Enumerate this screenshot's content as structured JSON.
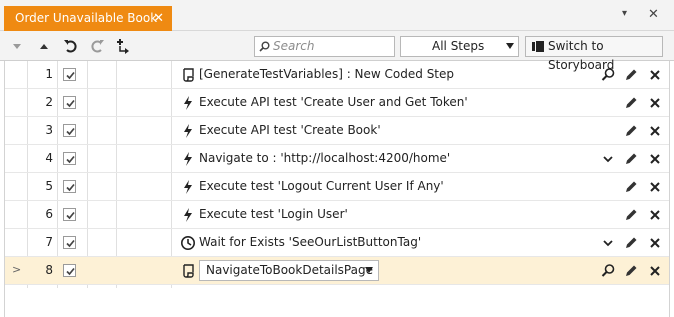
{
  "window": {
    "tab_title": "Order Unavailable Book",
    "tab_close": "✕",
    "menu_glyph": "▾",
    "close_glyph": "✕"
  },
  "toolbar": {
    "search_placeholder": "Search",
    "filter_value": "All Steps",
    "storyboard_label": "Switch to Storyboard"
  },
  "steps": [
    {
      "num": "1",
      "checked": true,
      "type_icon": "coded-step-icon",
      "text": "[GenerateTestVariables] : New Coded Step",
      "actions": [
        "search",
        "edit",
        "delete"
      ]
    },
    {
      "num": "2",
      "checked": true,
      "type_icon": "lightning-icon",
      "text": "Execute API test 'Create User and Get Token'",
      "actions": [
        "edit",
        "delete"
      ]
    },
    {
      "num": "3",
      "checked": true,
      "type_icon": "lightning-icon",
      "text": "Execute API test 'Create Book'",
      "actions": [
        "edit",
        "delete"
      ]
    },
    {
      "num": "4",
      "checked": true,
      "type_icon": "lightning-icon",
      "text": "Navigate to : 'http://localhost:4200/home'",
      "actions": [
        "expand",
        "edit",
        "delete"
      ]
    },
    {
      "num": "5",
      "checked": true,
      "type_icon": "lightning-icon",
      "text": "Execute test 'Logout Current User If Any'",
      "actions": [
        "edit",
        "delete"
      ]
    },
    {
      "num": "6",
      "checked": true,
      "type_icon": "lightning-icon",
      "text": "Execute test 'Login User'",
      "actions": [
        "edit",
        "delete"
      ]
    },
    {
      "num": "7",
      "checked": true,
      "type_icon": "clock-icon",
      "text": "Wait for Exists 'SeeOurListButtonTag'",
      "actions": [
        "expand",
        "edit",
        "delete"
      ]
    },
    {
      "num": "8",
      "checked": true,
      "type_icon": "coded-step-icon",
      "selected": true,
      "marker": ">",
      "select_value": "NavigateToBookDetailsPage",
      "actions": [
        "search",
        "edit",
        "delete"
      ]
    }
  ]
}
